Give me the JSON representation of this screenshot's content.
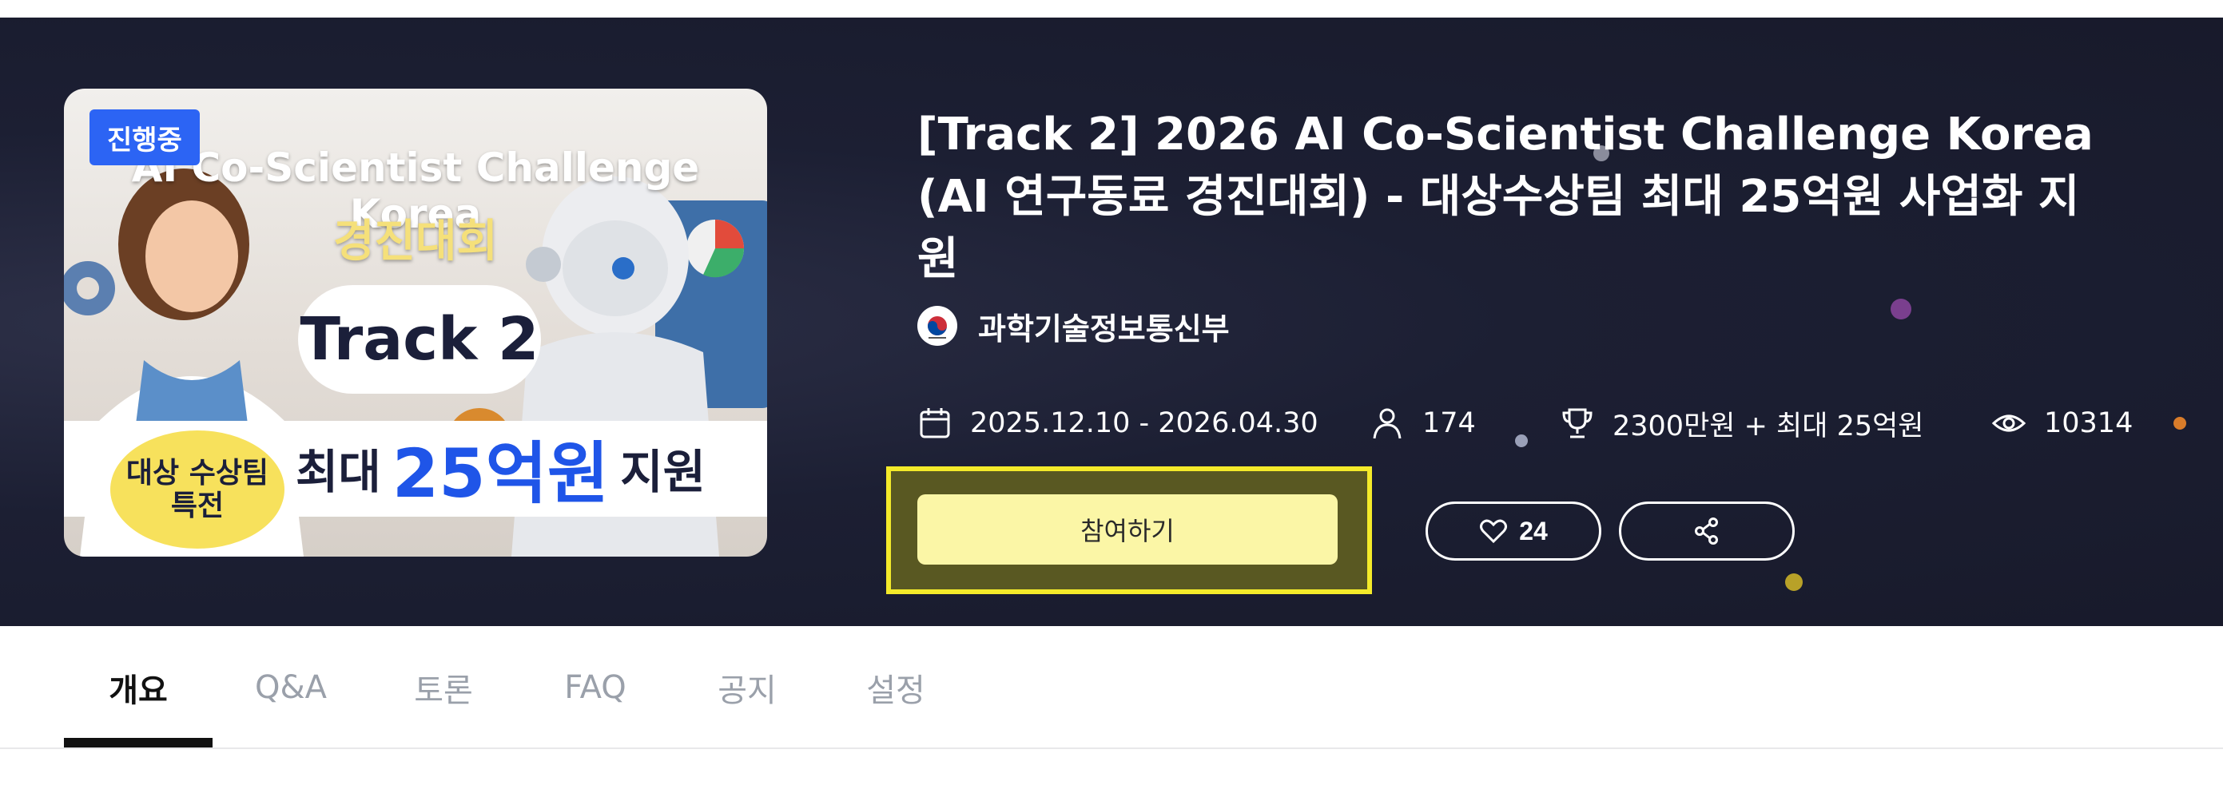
{
  "status_badge": "진행중",
  "thumbnail": {
    "title": "AI Co-Scientist Challenge Korea",
    "subtitle": "경진대회",
    "track": "Track 2",
    "badge_line1": "대상 수상팀",
    "badge_line2": "특전",
    "prize_prefix": "최대",
    "prize_amount": "25억원",
    "prize_suffix": "지원"
  },
  "title": "[Track 2] 2026 AI Co-Scientist Challenge Korea (AI 연구동료 경진대회) - 대상수상팀 최대 25억원 사업화 지원",
  "organizer": {
    "name": "과학기술정보통신부",
    "logo_icon": "ministry-emblem-icon"
  },
  "meta": {
    "period": "2025.12.10 - 2026.04.30",
    "participants": "174",
    "prize": "2300만원 + 최대 25억원",
    "views": "10314"
  },
  "actions": {
    "join_label": "참여하기",
    "like_count": "24",
    "like_icon": "heart-icon",
    "share_icon": "share-icon"
  },
  "tabs": [
    {
      "label": "개요",
      "active": true
    },
    {
      "label": "Q&A",
      "active": false
    },
    {
      "label": "토론",
      "active": false
    },
    {
      "label": "FAQ",
      "active": false
    },
    {
      "label": "공지",
      "active": false
    },
    {
      "label": "설정",
      "active": false
    }
  ],
  "colors": {
    "hero_bg": "#1c1f33",
    "badge_blue": "#2c64f4",
    "join_button": "#fbf6a6",
    "highlight_border": "#f4ea2a",
    "prize_blue": "#1f55e8",
    "oval_yellow": "#f7e15c"
  }
}
